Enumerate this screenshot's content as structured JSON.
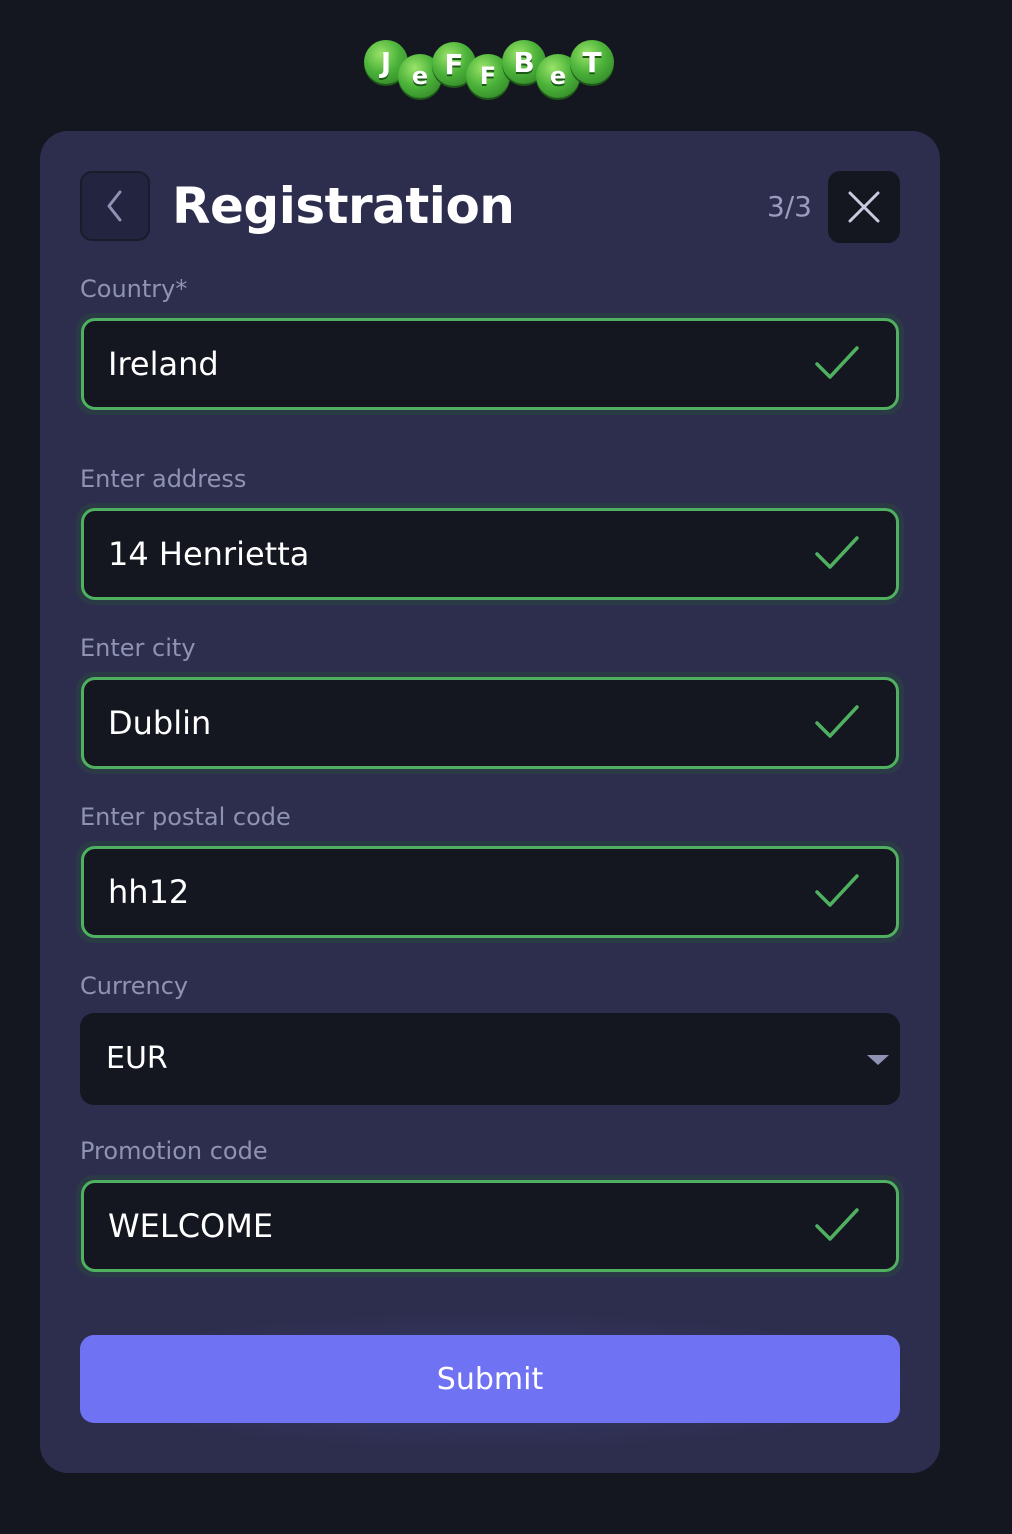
{
  "brand": {
    "logo_letters": [
      "J",
      "e",
      "F",
      "F",
      "B",
      "e",
      "T"
    ],
    "accent_green": "#4fb060",
    "button_color": "#6f72f2"
  },
  "header": {
    "back_icon": "chevron-left-icon",
    "title": "Registration",
    "step": "3/3",
    "close_icon": "close-icon"
  },
  "form": {
    "country": {
      "label": "Country*",
      "value": "Ireland",
      "status_icon": "check-icon"
    },
    "address": {
      "label": "Enter address",
      "value": "14 Henrietta",
      "status_icon": "check-icon"
    },
    "city": {
      "label": "Enter city",
      "value": "Dublin",
      "status_icon": "check-icon"
    },
    "postal": {
      "label": "Enter postal code",
      "value": "hh12",
      "status_icon": "check-icon"
    },
    "currency": {
      "label": "Currency",
      "value": "EUR",
      "dropdown_icon": "caret-down-icon"
    },
    "promo": {
      "label": "Promotion code",
      "value": "WELCOME",
      "status_icon": "check-icon"
    }
  },
  "actions": {
    "submit_label": "Submit"
  }
}
